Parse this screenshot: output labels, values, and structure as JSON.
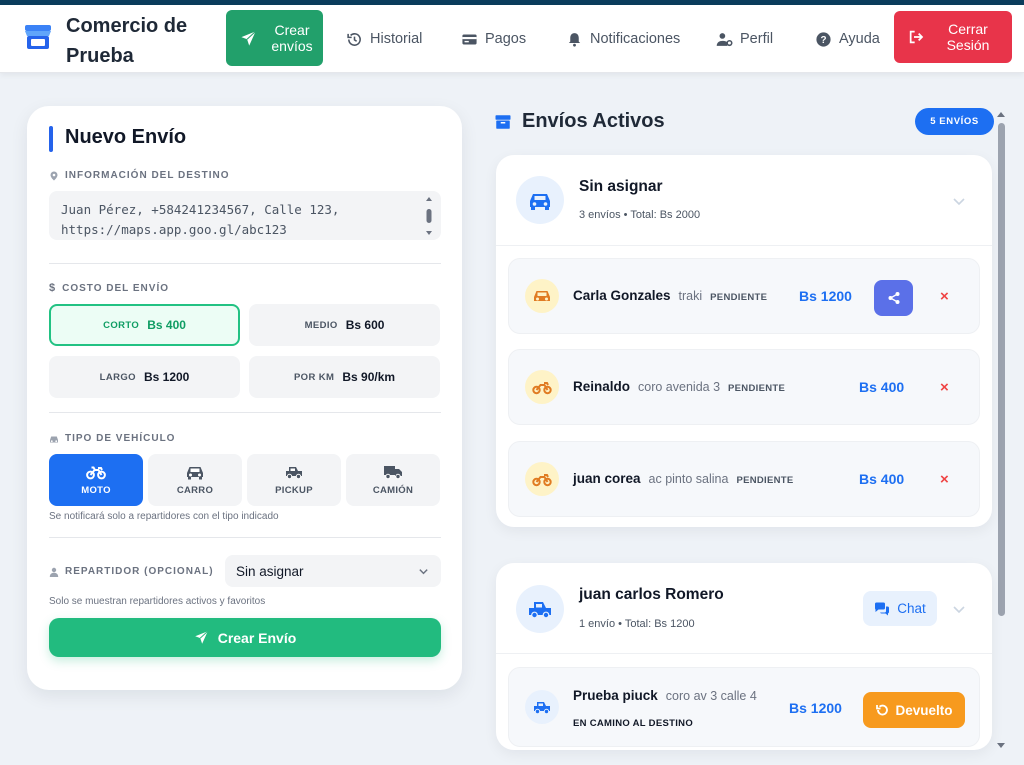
{
  "header": {
    "brand_title": "Comercio de Prueba",
    "nav": {
      "create": "Crear envíos",
      "history": "Historial",
      "payments": "Pagos",
      "notifications": "Notificaciones",
      "profile": "Perfil",
      "help": "Ayuda",
      "logout": "Cerrar Sesión"
    }
  },
  "form": {
    "title": "Nuevo Envío",
    "destination_label": "INFORMACIÓN DEL DESTINO",
    "destination_value": "Juan Pérez, +584241234567, Calle 123, https://maps.app.goo.gl/abc123",
    "cost_label": "COSTO DEL ENVÍO",
    "cost_options": [
      {
        "key": "CORTO",
        "value": "Bs 400",
        "selected": true
      },
      {
        "key": "MEDIO",
        "value": "Bs 600",
        "selected": false
      },
      {
        "key": "LARGO",
        "value": "Bs 1200",
        "selected": false
      },
      {
        "key": "POR KM",
        "value": "Bs 90/km",
        "selected": false
      }
    ],
    "vehicle_label": "TIPO DE VEHÍCULO",
    "vehicles": [
      {
        "name": "MOTO",
        "icon": "motorcycle-icon",
        "selected": true
      },
      {
        "name": "CARRO",
        "icon": "car-icon",
        "selected": false
      },
      {
        "name": "PICKUP",
        "icon": "pickup-icon",
        "selected": false
      },
      {
        "name": "CAMIÓN",
        "icon": "truck-icon",
        "selected": false
      }
    ],
    "vehicle_hint": "Se notificará solo a repartidores con el tipo indicado",
    "courier_label": "REPARTIDOR (OPCIONAL)",
    "courier_selected": "Sin asignar",
    "courier_hint": "Solo se muestran repartidores activos y favoritos",
    "submit": "Crear Envío"
  },
  "panel": {
    "title": "Envíos Activos",
    "count_badge": "5 ENVÍOS",
    "groups": [
      {
        "name": "Sin asignar",
        "summary": "3 envíos • Total: Bs 2000",
        "shipments": [
          {
            "name": "Carla Gonzales",
            "address": "traki",
            "status": "PENDIENTE",
            "price": "Bs 1200",
            "vehicle": "car-icon"
          },
          {
            "name": "Reinaldo",
            "address": "coro avenida 3",
            "status": "PENDIENTE",
            "price": "Bs 400",
            "vehicle": "motorcycle-icon"
          },
          {
            "name": "juan corea",
            "address": "ac pinto salina",
            "status": "PENDIENTE",
            "price": "Bs 400",
            "vehicle": "motorcycle-icon"
          }
        ]
      },
      {
        "name": "juan carlos Romero",
        "summary": "1 envío • Total: Bs 1200",
        "chat": "Chat",
        "shipments": [
          {
            "name": "Prueba piuck",
            "address": "coro av 3 calle 4",
            "status": "EN CAMINO AL DESTINO",
            "price": "Bs 1200",
            "vehicle": "pickup-icon",
            "action": "Devuelto"
          }
        ]
      }
    ],
    "remove_symbol": "×"
  },
  "colors": {
    "primary_green": "#22a06b",
    "primary_blue": "#1d6ff2",
    "danger": "#e8344a",
    "warning": "#f79a1e",
    "share": "#5b70e8"
  }
}
